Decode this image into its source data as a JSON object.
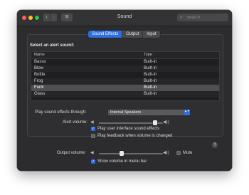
{
  "window": {
    "title": "Sound",
    "back_glyph": "‹",
    "forward_glyph": "›",
    "grid_glyph": "⊞",
    "search": {
      "placeholder": "Search",
      "icon": "search-icon",
      "glyph": "⌕"
    }
  },
  "tabs": [
    {
      "label": "Sound Effects",
      "active": true
    },
    {
      "label": "Output",
      "active": false
    },
    {
      "label": "Input",
      "active": false
    }
  ],
  "alert": {
    "section_title": "Select an alert sound:",
    "columns": {
      "name": "Name",
      "type": "Type"
    },
    "rows": [
      {
        "name": "Basso",
        "type": "Built-in"
      },
      {
        "name": "Blow",
        "type": "Built-in"
      },
      {
        "name": "Bottle",
        "type": "Built-in"
      },
      {
        "name": "Frog",
        "type": "Built-in"
      },
      {
        "name": "Funk",
        "type": "Built-in",
        "selected": true
      },
      {
        "name": "Glass",
        "type": "Built-in"
      }
    ]
  },
  "effects": {
    "play_through_label": "Play sound effects through:",
    "play_through_value": "Internal Speakers",
    "alert_volume_label": "Alert volume:",
    "alert_volume_level": 0.88,
    "play_ui_sounds_label": "Play user interface sound effects",
    "play_ui_sounds_checked": true,
    "play_feedback_label": "Play feedback when volume is changed",
    "play_feedback_checked": false
  },
  "output": {
    "volume_label": "Output volume:",
    "volume_level": 0.35,
    "mute_label": "Mute",
    "mute_checked": false,
    "show_in_menubar_label": "Show volume in menu bar",
    "show_in_menubar_checked": true
  },
  "glyphs": {
    "speaker_low": "◀",
    "speaker_high": "◀))",
    "check": "✓",
    "help": "?",
    "select_arrows": "▲▼"
  },
  "colors": {
    "accent": "#2b6fe0",
    "window_bg": "#2c2c2e"
  }
}
